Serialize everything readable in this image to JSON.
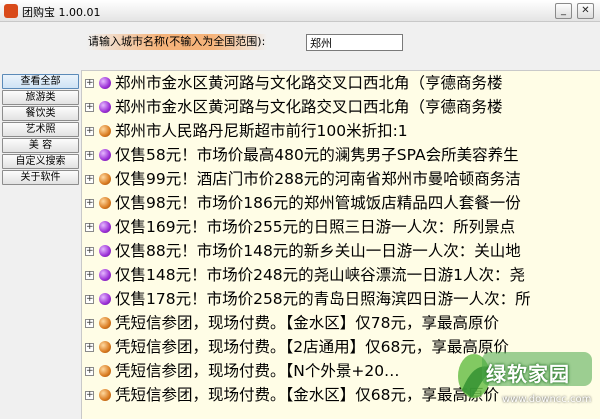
{
  "window": {
    "title": "团购宝 1.00.01",
    "minimize_icon": "minimize-icon",
    "close_icon": "close-icon"
  },
  "search": {
    "label": "请输入城市名称(不输入为全国范围):",
    "value": "郑州"
  },
  "sidebar": {
    "items": [
      {
        "label": "查看全部",
        "active": true
      },
      {
        "label": "旅游类"
      },
      {
        "label": "餐饮类"
      },
      {
        "label": "艺术照"
      },
      {
        "label": "美 容"
      },
      {
        "label": "自定义搜索"
      },
      {
        "label": "关于软件"
      }
    ]
  },
  "deals": [
    {
      "bullet": "purple",
      "text": "郑州市金水区黄河路与文化路交叉口西北角（亨德商务楼"
    },
    {
      "bullet": "purple",
      "text": "郑州市金水区黄河路与文化路交叉口西北角（亨德商务楼"
    },
    {
      "bullet": "orange",
      "text": "郑州市人民路丹尼斯超市前行100米折扣:1"
    },
    {
      "bullet": "purple",
      "text": "仅售58元！市场价最高480元的澜隽男子SPA会所美容养生"
    },
    {
      "bullet": "orange",
      "text": "仅售99元！酒店门市价288元的河南省郑州市曼哈顿商务洁"
    },
    {
      "bullet": "orange",
      "text": "仅售98元！市场价186元的郑州管城饭店精品四人套餐一份"
    },
    {
      "bullet": "purple",
      "text": "仅售169元！市场价255元的日照三日游一人次：所列景点"
    },
    {
      "bullet": "purple",
      "text": "仅售88元！市场价148元的新乡关山一日游一人次：关山地"
    },
    {
      "bullet": "purple",
      "text": "仅售148元！市场价248元的尧山峡谷漂流一日游1人次：尧"
    },
    {
      "bullet": "purple",
      "text": "仅售178元！市场价258元的青岛日照海滨四日游一人次：所"
    },
    {
      "bullet": "orange",
      "text": "凭短信参团，现场付费。【金水区】仅78元，享最高原价"
    },
    {
      "bullet": "orange",
      "text": "凭短信参团，现场付费。【2店通用】仅68元，享最高原价"
    },
    {
      "bullet": "orange",
      "text": "凭短信参团，现场付费。【N个外景+20…"
    },
    {
      "bullet": "orange",
      "text": "凭短信参团，现场付费。【金水区】仅68元，享最高原价"
    }
  ],
  "watermark": {
    "text": "绿软家园",
    "sub": "www.downcc.com"
  },
  "colors": {
    "list_background": "#fffde6",
    "label_highlight": "#f5b37a",
    "bullet_purple": "#9b2fd6",
    "bullet_orange": "#d97a1f"
  }
}
